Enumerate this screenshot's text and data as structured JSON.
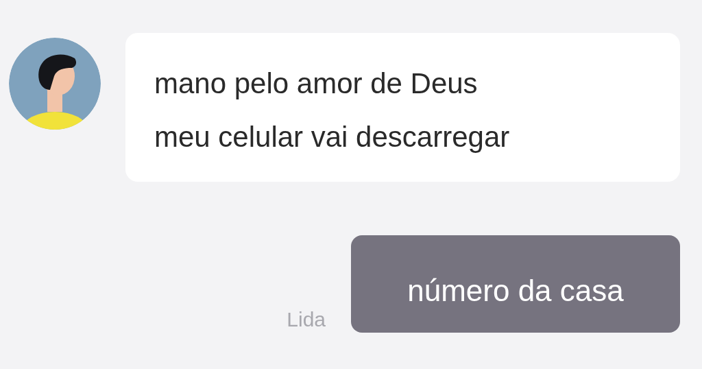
{
  "messages": [
    {
      "kind": "incoming",
      "lines": [
        "mano pelo amor de Deus",
        "meu celular vai descarregar"
      ]
    },
    {
      "kind": "outgoing",
      "lines": [
        "número da casa"
      ],
      "status": "Lida"
    }
  ]
}
